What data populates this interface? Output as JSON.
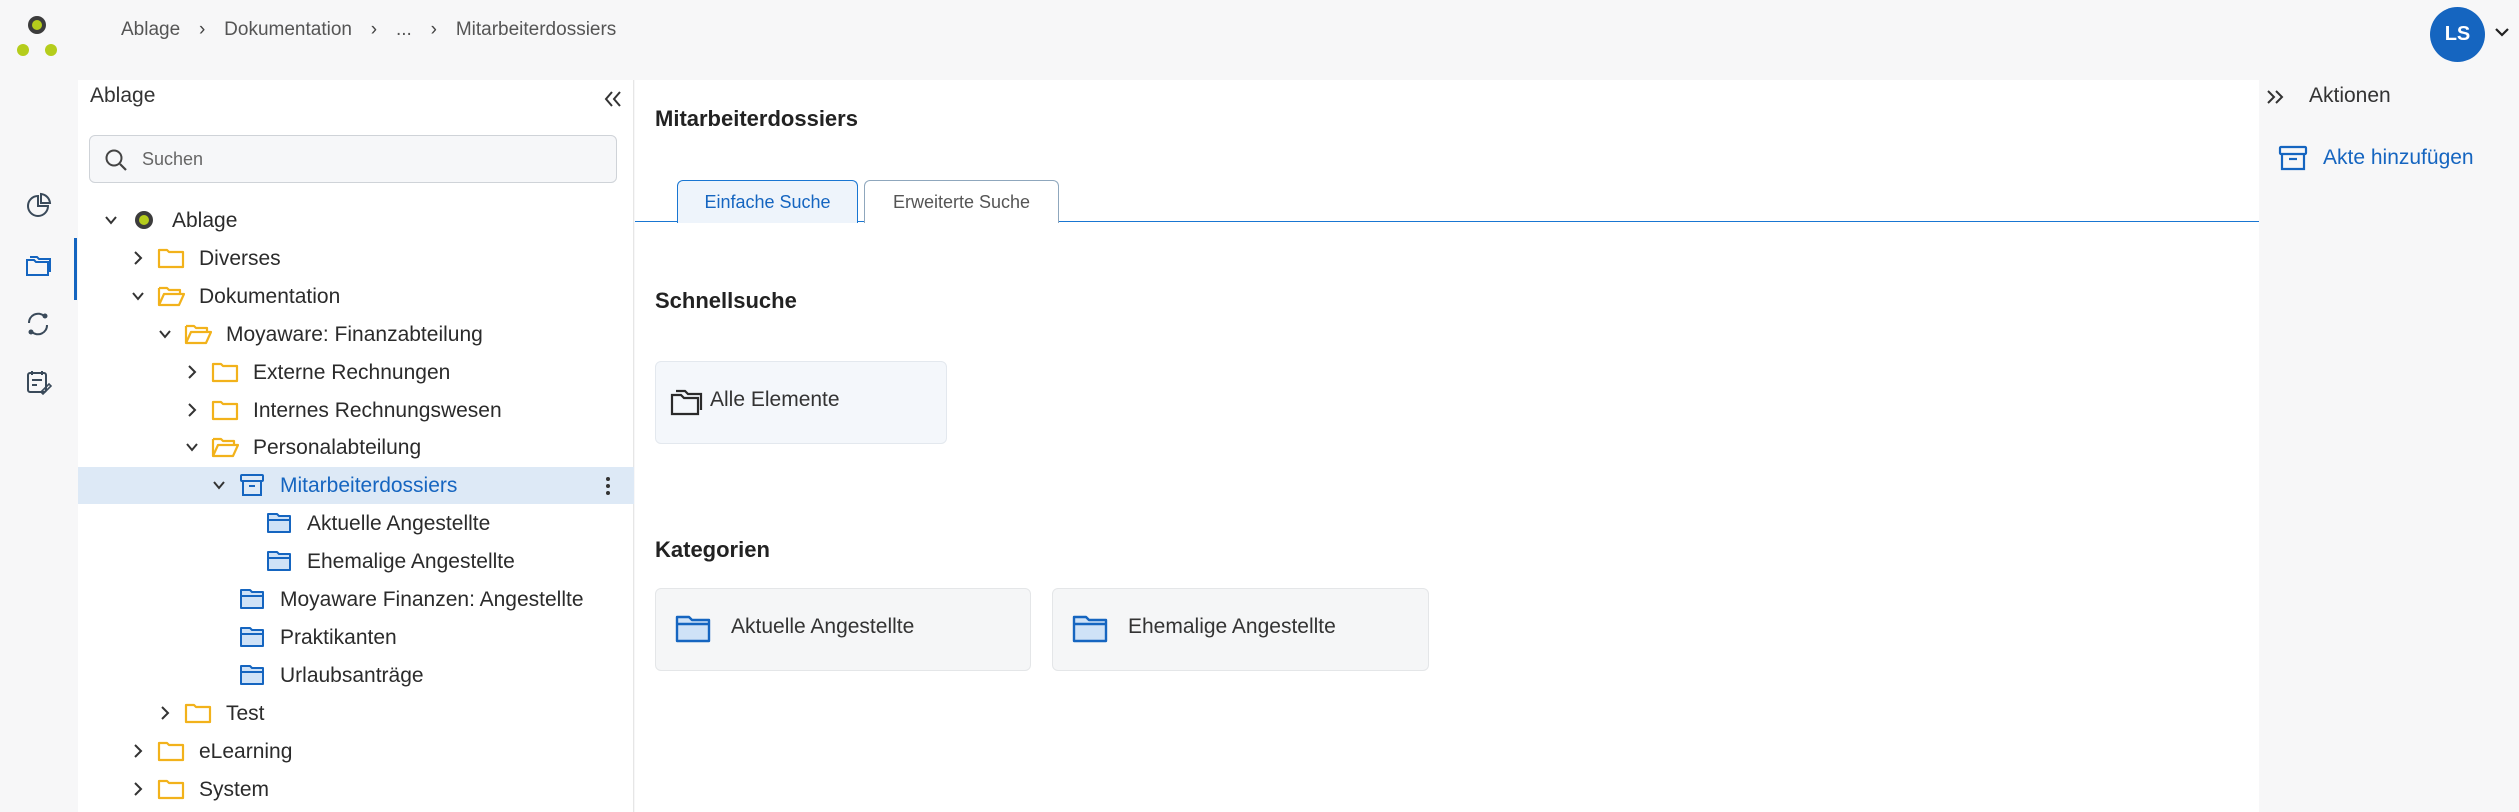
{
  "breadcrumb": [
    "Ablage",
    "Dokumentation",
    "...",
    "Mitarbeiterdossiers"
  ],
  "user": {
    "initials": "LS"
  },
  "colors": {
    "accent": "#1565c0",
    "folder_yellow": "#f2b21b",
    "logo_green": "#b5cd1c"
  },
  "rail": {
    "items": [
      {
        "icon": "dashboard-icon"
      },
      {
        "icon": "folders-icon",
        "active": true
      },
      {
        "icon": "sync-icon"
      },
      {
        "icon": "tasks-icon"
      }
    ]
  },
  "tree_panel": {
    "title": "Ablage",
    "search_placeholder": "Suchen",
    "nodes": [
      {
        "label": "Ablage",
        "level": 0,
        "expanded": true,
        "type": "root"
      },
      {
        "label": "Diverses",
        "level": 1,
        "expanded": false,
        "type": "folder"
      },
      {
        "label": "Dokumentation",
        "level": 1,
        "expanded": true,
        "type": "folder-open"
      },
      {
        "label": "Moyaware: Finanzabteilung",
        "level": 2,
        "expanded": true,
        "type": "folder-open"
      },
      {
        "label": "Externe Rechnungen",
        "level": 3,
        "expanded": false,
        "type": "folder"
      },
      {
        "label": "Internes Rechnungswesen",
        "level": 3,
        "expanded": false,
        "type": "folder"
      },
      {
        "label": "Personalabteilung",
        "level": 3,
        "expanded": true,
        "type": "folder-open"
      },
      {
        "label": "Mitarbeiterdossiers",
        "level": 4,
        "expanded": true,
        "type": "archive",
        "selected": true
      },
      {
        "label": "Aktuelle Angestellte",
        "level": 5,
        "type": "category"
      },
      {
        "label": "Ehemalige Angestellte",
        "level": 5,
        "type": "category"
      },
      {
        "label": "Moyaware Finanzen: Angestellte",
        "level": 4,
        "type": "category"
      },
      {
        "label": "Praktikanten",
        "level": 4,
        "type": "category"
      },
      {
        "label": "Urlaubsanträge",
        "level": 4,
        "type": "category"
      },
      {
        "label": "Test",
        "level": 2,
        "expanded": false,
        "type": "folder"
      },
      {
        "label": "eLearning",
        "level": 1,
        "expanded": false,
        "type": "folder"
      },
      {
        "label": "System",
        "level": 1,
        "expanded": false,
        "type": "folder"
      }
    ]
  },
  "main": {
    "title": "Mitarbeiterdossiers",
    "tabs": [
      {
        "label": "Einfache Suche",
        "active": true
      },
      {
        "label": "Erweiterte Suche",
        "active": false
      }
    ],
    "quick_search": {
      "title": "Schnellsuche",
      "items": [
        {
          "label": "Alle Elemente"
        }
      ]
    },
    "categories": {
      "title": "Kategorien",
      "items": [
        {
          "label": "Aktuelle Angestellte"
        },
        {
          "label": "Ehemalige Angestellte"
        }
      ]
    }
  },
  "actions": {
    "title": "Aktionen",
    "add_label": "Akte hinzufügen"
  }
}
